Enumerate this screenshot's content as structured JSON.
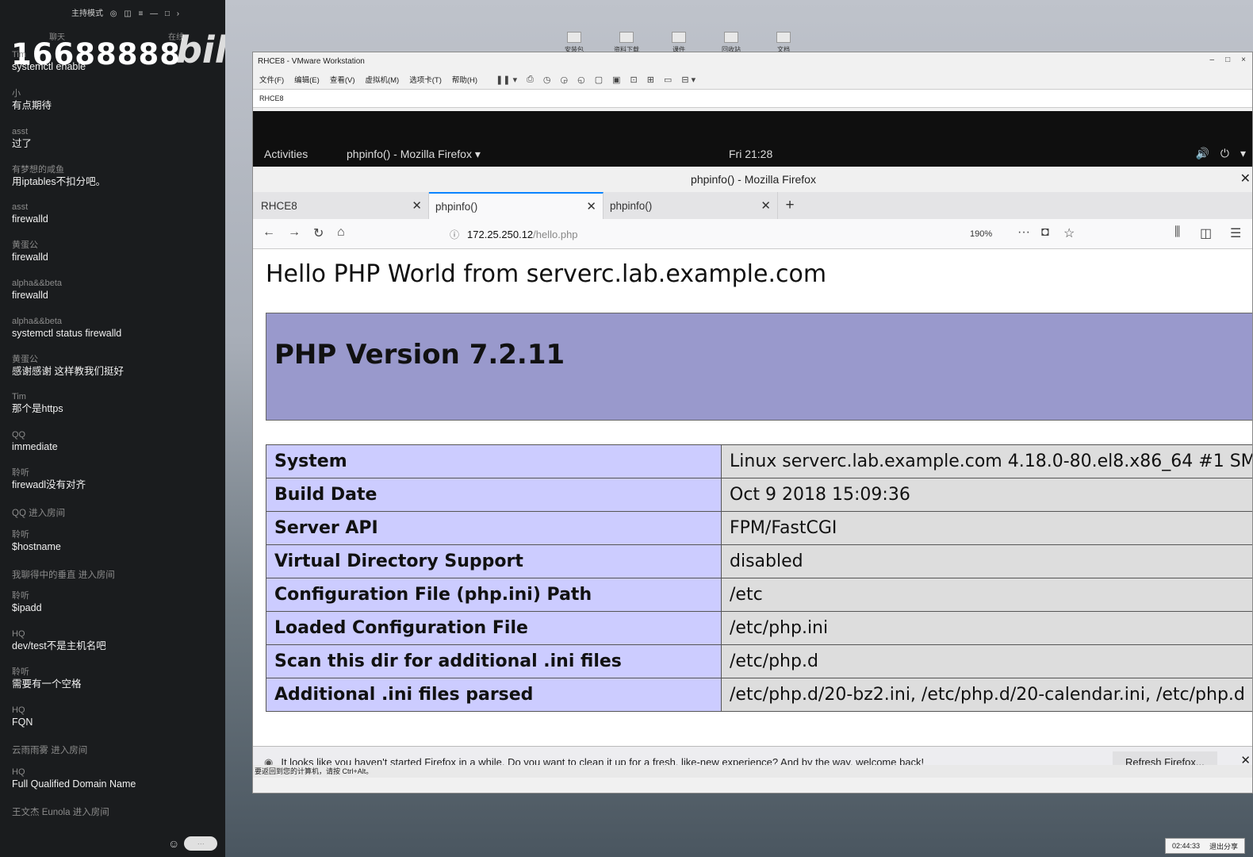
{
  "chat": {
    "header_items": [
      "主持模式",
      "◎",
      "◫",
      "≡",
      "—",
      "□",
      "›"
    ],
    "subheader": [
      "聊天",
      "在线"
    ],
    "count": "16688888",
    "logo": "bilibili",
    "messages": [
      {
        "user": "Tim",
        "text": "systemctl enable"
      },
      {
        "user": "小",
        "text": "有点期待"
      },
      {
        "user": "asst",
        "text": "过了"
      },
      {
        "user": "有梦想的咸鱼",
        "text": "用iptables不扣分吧。"
      },
      {
        "user": "asst",
        "text": "firewalld"
      },
      {
        "user": "黄蛋公",
        "text": "firewalld"
      },
      {
        "user": "alpha&&beta",
        "text": "firewalld"
      },
      {
        "user": "alpha&&beta",
        "text": "systemctl status firewalld"
      },
      {
        "user": "黄蛋公",
        "text": "感谢感谢  这样教我们挺好"
      },
      {
        "user": "Tim",
        "text": "那个是https"
      },
      {
        "user": "QQ",
        "text": "immediate"
      },
      {
        "user": "聆听",
        "text": "firewadl没有对齐"
      },
      {
        "user": "",
        "text": "QQ 进入房间",
        "sys": true
      },
      {
        "user": "聆听",
        "text": "$hostname"
      },
      {
        "user": "",
        "text": "我聊得中的垂直 进入房间",
        "sys": true
      },
      {
        "user": "聆听",
        "text": "$ipadd"
      },
      {
        "user": "HQ",
        "text": "dev/test不是主机名吧"
      },
      {
        "user": "聆听",
        "text": "需要有一个空格"
      },
      {
        "user": "HQ",
        "text": "FQN"
      },
      {
        "user": "",
        "text": "云雨雨雾 进入房间",
        "sys": true
      },
      {
        "user": "HQ",
        "text": "Full Qualified Domain Name"
      },
      {
        "user": "",
        "text": "王文杰 Eunola 进入房间",
        "sys": true
      }
    ],
    "smile_icon": "smile-icon",
    "send_label": "···"
  },
  "desktop": {
    "icons": [
      "安装包",
      "资料下载",
      "课件",
      "回收站",
      "文档"
    ]
  },
  "vmware": {
    "title": "RHCE8 - VMware Workstation",
    "controls": [
      "–",
      "□",
      "×"
    ],
    "menus": [
      "文件(F)",
      "编辑(E)",
      "查看(V)",
      "虚拟机(M)",
      "选项卡(T)",
      "帮助(H)"
    ],
    "toolbar_icons": [
      "❚❚ ▾",
      "⎙",
      "◷",
      "◶",
      "◵",
      "▢",
      "▣",
      "⊡",
      "⊞",
      "▭",
      "⊟ ▾"
    ],
    "vm_tab": "RHCE8",
    "status_text": "要返回到您的计算机，请按 Ctrl+Alt。"
  },
  "gnome": {
    "activities": "Activities",
    "app": "phpinfo() - Mozilla Firefox ▾",
    "clock": "Fri 21:28",
    "tray": [
      "🔊",
      "⏻",
      "▾"
    ]
  },
  "firefox": {
    "title": "phpinfo() - Mozilla Firefox",
    "tabs": [
      {
        "label": "RHCE8"
      },
      {
        "label": "phpinfo()"
      },
      {
        "label": "phpinfo()"
      }
    ],
    "url_host": "172.25.250.12",
    "url_path": "/hello.php",
    "zoom": "190%",
    "notification": "It looks like you haven't started Firefox in a while. Do you want to clean it up for a fresh, like-new experience? And by the way, welcome back!",
    "refresh_label": "Refresh Firefox..."
  },
  "page": {
    "hello": "Hello PHP World from serverc.lab.example.com",
    "version": "PHP Version 7.2.11",
    "rows": [
      {
        "key": "System",
        "value": "Linux serverc.lab.example.com 4.18.0-80.el8.x86_64 #1 SM"
      },
      {
        "key": "Build Date",
        "value": "Oct 9 2018 15:09:36"
      },
      {
        "key": "Server API",
        "value": "FPM/FastCGI"
      },
      {
        "key": "Virtual Directory Support",
        "value": "disabled"
      },
      {
        "key": "Configuration File (php.ini) Path",
        "value": "/etc"
      },
      {
        "key": "Loaded Configuration File",
        "value": "/etc/php.ini"
      },
      {
        "key": "Scan this dir for additional .ini files",
        "value": "/etc/php.d"
      },
      {
        "key": "Additional .ini files parsed",
        "value": "/etc/php.d/20-bz2.ini, /etc/php.d/20-calendar.ini, /etc/php.d"
      }
    ]
  },
  "taskbar": {
    "time": "02:44:33",
    "exit_label": "退出分享"
  }
}
